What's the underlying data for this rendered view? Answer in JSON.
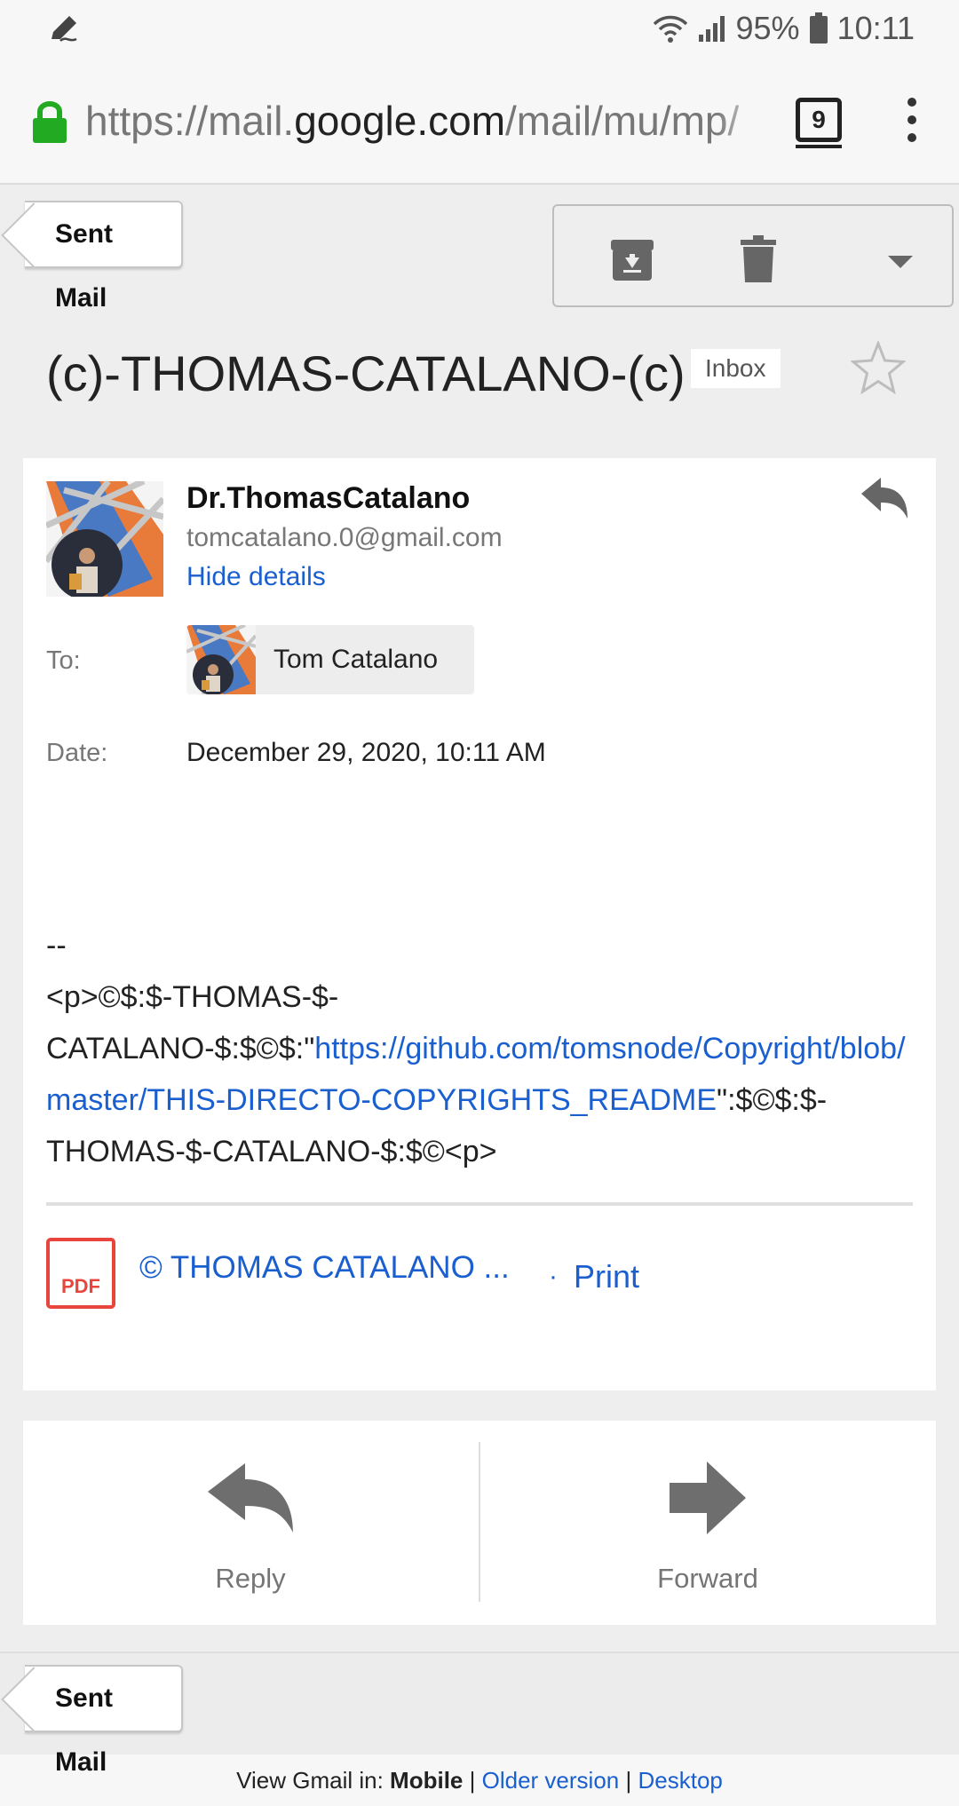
{
  "status_bar": {
    "battery_percent": "95%",
    "time": "10:11",
    "icons": [
      "pen-icon",
      "wifi-icon",
      "signal-icon",
      "battery-icon"
    ]
  },
  "browser": {
    "url_prefix": "https://mail.",
    "url_domain": "google.com",
    "url_path": "/mail/mu/mp/",
    "tab_count": "9",
    "lock_color": "#22aa22"
  },
  "top_nav": {
    "back_label": "Sent Mail",
    "toolbar_icons": [
      "archive-icon",
      "trash-icon",
      "more-dropdown-icon"
    ]
  },
  "email": {
    "subject": "(c)-THOMAS-CATALANO-(c)",
    "label": "Inbox",
    "sender_name": "Dr.ThomasCatalano",
    "sender_email": "tomcatalano.0@gmail.com",
    "hide_details": "Hide details",
    "to_label": "To:",
    "to_name": "Tom Catalano",
    "date_label": "Date:",
    "date_value": "December 29, 2020, 10:11 AM",
    "body_sig": "--",
    "body_prefix": "<p>©$:$-THOMAS-$-CATALANO-$:$©$:\"",
    "body_link": "https://github.com/tomsnode/Copyright/blob/master/THIS-DIRECTO-COPYRIGHTS_README",
    "body_suffix": "\":$©$:$-THOMAS-$-CATALANO-$:$©<p>",
    "attachment_name": "© THOMAS CATALANO ...",
    "attachment_sep": "·",
    "print_label": "Print",
    "pdf_label": "PDF"
  },
  "actions": {
    "reply": "Reply",
    "forward": "Forward"
  },
  "bottom_nav": {
    "back_label": "Sent Mail"
  },
  "footer": {
    "prefix": "View Gmail in:",
    "mobile": "Mobile",
    "sep": "|",
    "older": "Older version",
    "desktop": "Desktop"
  },
  "colors": {
    "link": "#1a5fd0",
    "pdf_red": "#e8453c",
    "icon_gray": "#666666"
  }
}
